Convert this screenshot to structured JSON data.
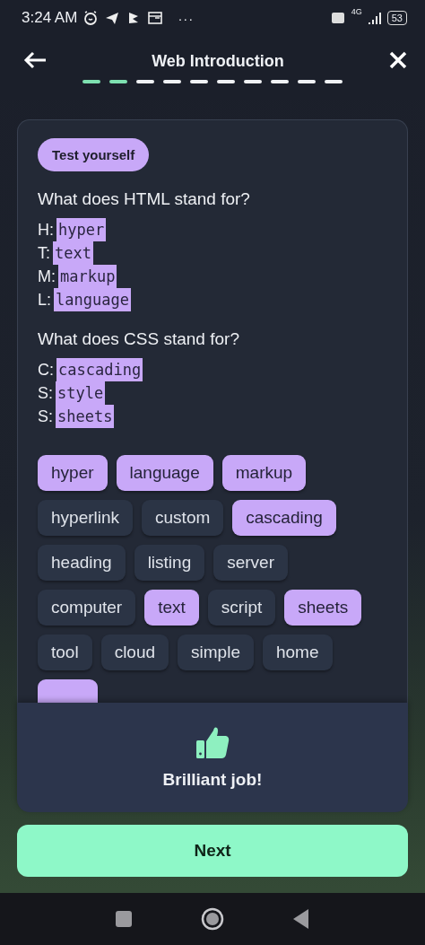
{
  "status_bar": {
    "time": "3:24 AM",
    "more": "···",
    "network": "4G",
    "battery": "53"
  },
  "header": {
    "title": "Web Introduction",
    "progress": [
      {
        "done": true
      },
      {
        "done": true
      },
      {
        "done": false
      },
      {
        "done": false
      },
      {
        "done": false
      },
      {
        "done": false
      },
      {
        "done": false
      },
      {
        "done": false
      },
      {
        "done": false
      },
      {
        "done": false
      }
    ]
  },
  "card": {
    "badge": "Test yourself",
    "questions": [
      {
        "text": "What does HTML stand for?",
        "answers": [
          {
            "letter": "H:",
            "answer": "hyper"
          },
          {
            "letter": "T:",
            "answer": "text"
          },
          {
            "letter": "M:",
            "answer": "markup"
          },
          {
            "letter": "L:",
            "answer": "language"
          }
        ]
      },
      {
        "text": "What does CSS stand for?",
        "answers": [
          {
            "letter": "C:",
            "answer": "cascading"
          },
          {
            "letter": "S:",
            "answer": "style"
          },
          {
            "letter": "S:",
            "answer": "sheets"
          }
        ]
      }
    ],
    "chips": [
      {
        "label": "hyper",
        "selected": true
      },
      {
        "label": "language",
        "selected": true
      },
      {
        "label": "markup",
        "selected": true
      },
      {
        "label": "hyperlink",
        "selected": false
      },
      {
        "label": "custom",
        "selected": false
      },
      {
        "label": "cascading",
        "selected": true
      },
      {
        "label": "heading",
        "selected": false
      },
      {
        "label": "listing",
        "selected": false
      },
      {
        "label": "server",
        "selected": false
      },
      {
        "label": "computer",
        "selected": false
      },
      {
        "label": "text",
        "selected": true
      },
      {
        "label": "script",
        "selected": false
      },
      {
        "label": "sheets",
        "selected": true
      },
      {
        "label": "tool",
        "selected": false
      },
      {
        "label": "cloud",
        "selected": false
      },
      {
        "label": "simple",
        "selected": false
      },
      {
        "label": "home",
        "selected": false
      },
      {
        "selected": true
      }
    ]
  },
  "feedback": {
    "message": "Brilliant job!"
  },
  "next_button": {
    "label": "Next"
  }
}
